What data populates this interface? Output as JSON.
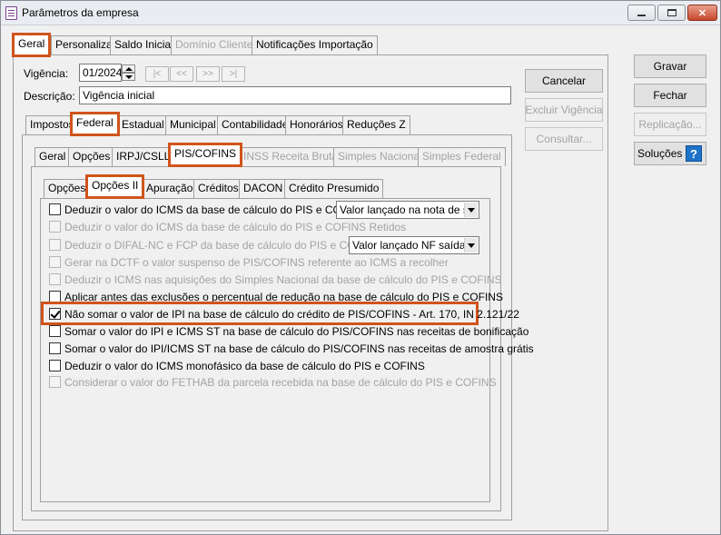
{
  "window": {
    "title": "Parâmetros da empresa",
    "minimize": "",
    "maximize": "",
    "close": "✕"
  },
  "top_tabs": [
    "Geral",
    "Personaliza",
    "Saldo Inicial",
    "Domínio Cliente",
    "Notificações Importação"
  ],
  "vigencia": {
    "label": "Vigência:",
    "value": "01/2024"
  },
  "descricao": {
    "label": "Descrição:",
    "value": "Vigência inicial"
  },
  "nav_buttons": [
    "|<",
    "<<",
    ">>",
    ">|"
  ],
  "mid_buttons": {
    "cancelar": "Cancelar",
    "excluir": "Excluir Vigência",
    "consultar": "Consultar..."
  },
  "right_buttons": {
    "gravar": "Gravar",
    "fechar": "Fechar",
    "replicacao": "Replicação...",
    "solucoes": "Soluções",
    "help": "?"
  },
  "tabs_level2": [
    "Impostos",
    "Federal",
    "Estadual",
    "Municipal",
    "Contabilidade",
    "Honorários",
    "Reduções Z"
  ],
  "tabs_level3": [
    "Geral",
    "Opções",
    "IRPJ/CSLL",
    "PIS/COFINS",
    "INSS Receita Bruta",
    "Simples Nacional",
    "Simples Federal"
  ],
  "tabs_level4": [
    "Opções",
    "Opções II",
    "Apuração",
    "Créditos",
    "DACON",
    "Crédito Presumido"
  ],
  "options": [
    {
      "label": "Deduzir o valor do ICMS da base de cálculo do PIS e COFINS:",
      "checked": false,
      "disabled": false,
      "select": "Valor lançado na nota de saí"
    },
    {
      "label": "Deduzir o valor do ICMS da base de cálculo do PIS e COFINS Retidos",
      "checked": false,
      "disabled": true
    },
    {
      "label": "Deduzir o DIFAL-NC e FCP da base de cálculo do PIS e COFINS:",
      "checked": false,
      "disabled": true,
      "select": "Valor lançado NF saída/d"
    },
    {
      "label": "Gerar na DCTF o valor suspenso de PIS/COFINS referente ao ICMS a recolher",
      "checked": false,
      "disabled": true
    },
    {
      "label": "Deduzir o ICMS nas aquisições do Simples Nacional da base de cálculo do PIS e COFINS",
      "checked": false,
      "disabled": true
    },
    {
      "label": "Aplicar antes das exclusões o percentual de redução na base de cálculo do PIS e COFINS",
      "checked": false,
      "disabled": false
    },
    {
      "label": "Não somar o valor de IPI na base de cálculo do crédito de PIS/COFINS - Art. 170, IN 2.121/22",
      "checked": true,
      "disabled": false
    },
    {
      "label": "Somar o valor do IPI e ICMS ST na base de cálculo do PIS/COFINS nas receitas de bonificação",
      "checked": false,
      "disabled": false
    },
    {
      "label": "Somar o valor do IPI/ICMS ST na base de cálculo do PIS/COFINS nas receitas de amostra grátis",
      "checked": false,
      "disabled": false
    },
    {
      "label": "Deduzir o valor do ICMS monofásico da base de cálculo do PIS e COFINS",
      "checked": false,
      "disabled": false
    },
    {
      "label": "Considerar o valor do FETHAB da parcela recebida na base de cálculo do PIS e COFINS",
      "checked": false,
      "disabled": true
    }
  ],
  "colors": {
    "highlight": "#d0541b",
    "window_bg": "#f0f0f0",
    "disabled_text": "#a3a3a3"
  }
}
